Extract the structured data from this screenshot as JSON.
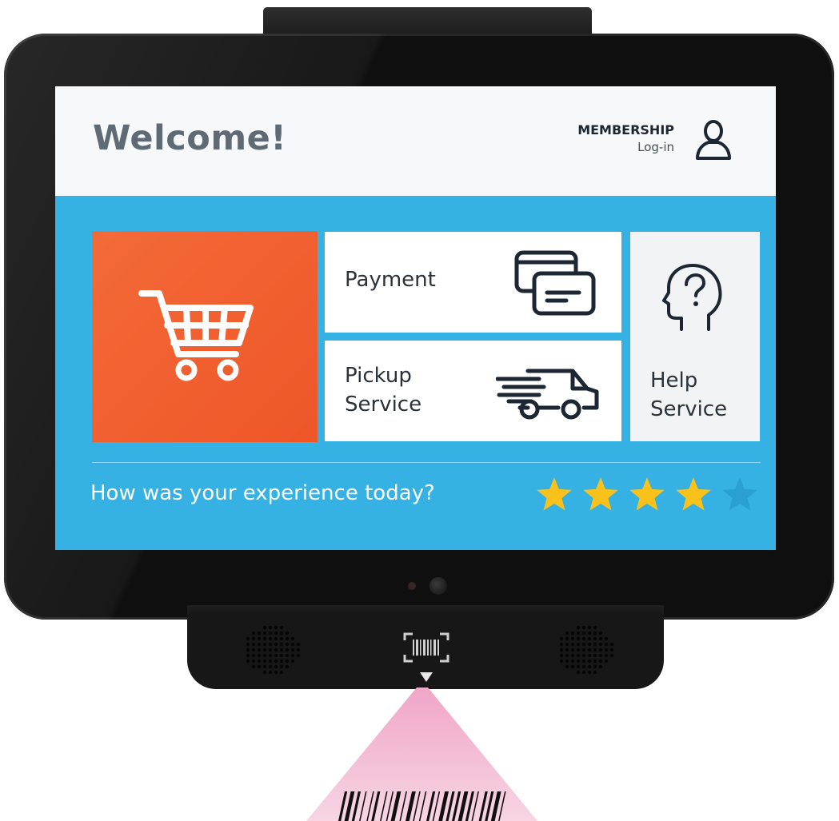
{
  "header": {
    "title": "Welcome!",
    "membership_title": "MEMBERSHIP",
    "membership_sub": "Log-in"
  },
  "tiles": {
    "cart": {
      "icon": "shopping-cart-icon"
    },
    "payment": {
      "label": "Payment",
      "icon": "credit-cards-icon"
    },
    "pickup": {
      "label_line1": "Pickup",
      "label_line2": "Service",
      "icon": "delivery-van-icon"
    },
    "help": {
      "label_line1": "Help",
      "label_line2": "Service",
      "icon": "head-question-icon"
    }
  },
  "feedback": {
    "question": "How was your experience today?",
    "rating": 4,
    "max_rating": 5
  },
  "colors": {
    "screen_blue": "#36b1e3",
    "cart_orange": "#f0582b",
    "star_gold": "#f8c21b",
    "star_inactive": "#2a9fd3",
    "header_bg": "#f6f8f9",
    "beam_pink": "#e9a3c4"
  },
  "icons": [
    "user-icon",
    "shopping-cart-icon",
    "credit-cards-icon",
    "delivery-van-icon",
    "head-question-icon",
    "star-icon",
    "barcode-scanner-icon",
    "speaker-grille-icon"
  ]
}
